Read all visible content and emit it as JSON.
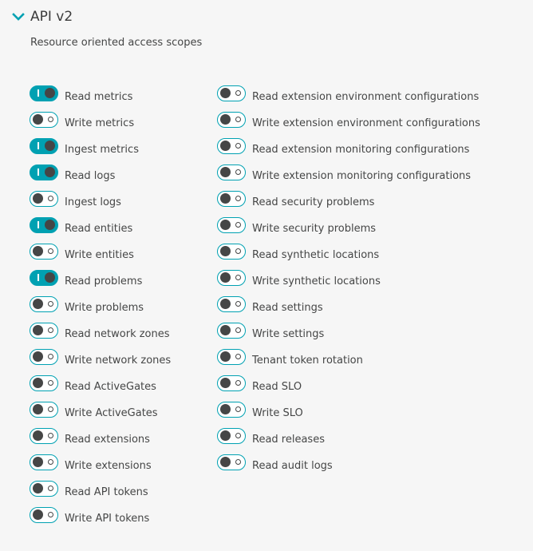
{
  "section": {
    "title": "API v2",
    "expanded": true,
    "chevron_icon": "chevron-down-icon",
    "subtitle": "Resource oriented access scopes"
  },
  "colors": {
    "accent": "#00a1b2",
    "knob": "#454646",
    "text": "#454646",
    "background": "#f6f6f6"
  },
  "scopes_left": [
    {
      "label": "Read metrics",
      "enabled": true
    },
    {
      "label": "Write metrics",
      "enabled": false
    },
    {
      "label": "Ingest metrics",
      "enabled": true
    },
    {
      "label": "Read logs",
      "enabled": true
    },
    {
      "label": "Ingest logs",
      "enabled": false
    },
    {
      "label": "Read entities",
      "enabled": true
    },
    {
      "label": "Write entities",
      "enabled": false
    },
    {
      "label": "Read problems",
      "enabled": true
    },
    {
      "label": "Write problems",
      "enabled": false
    },
    {
      "label": "Read network zones",
      "enabled": false
    },
    {
      "label": "Write network zones",
      "enabled": false
    },
    {
      "label": "Read ActiveGates",
      "enabled": false
    },
    {
      "label": "Write ActiveGates",
      "enabled": false
    },
    {
      "label": "Read extensions",
      "enabled": false
    },
    {
      "label": "Write extensions",
      "enabled": false
    },
    {
      "label": "Read API tokens",
      "enabled": false
    },
    {
      "label": "Write API tokens",
      "enabled": false
    }
  ],
  "scopes_right": [
    {
      "label": "Read extension environment configurations",
      "enabled": false
    },
    {
      "label": "Write extension environment configurations",
      "enabled": false
    },
    {
      "label": "Read extension monitoring configurations",
      "enabled": false
    },
    {
      "label": "Write extension monitoring configurations",
      "enabled": false
    },
    {
      "label": "Read security problems",
      "enabled": false
    },
    {
      "label": "Write security problems",
      "enabled": false
    },
    {
      "label": "Read synthetic locations",
      "enabled": false
    },
    {
      "label": "Write synthetic locations",
      "enabled": false
    },
    {
      "label": "Read settings",
      "enabled": false
    },
    {
      "label": "Write settings",
      "enabled": false
    },
    {
      "label": "Tenant token rotation",
      "enabled": false
    },
    {
      "label": "Read SLO",
      "enabled": false
    },
    {
      "label": "Write SLO",
      "enabled": false
    },
    {
      "label": "Read releases",
      "enabled": false
    },
    {
      "label": "Read audit logs",
      "enabled": false
    }
  ]
}
